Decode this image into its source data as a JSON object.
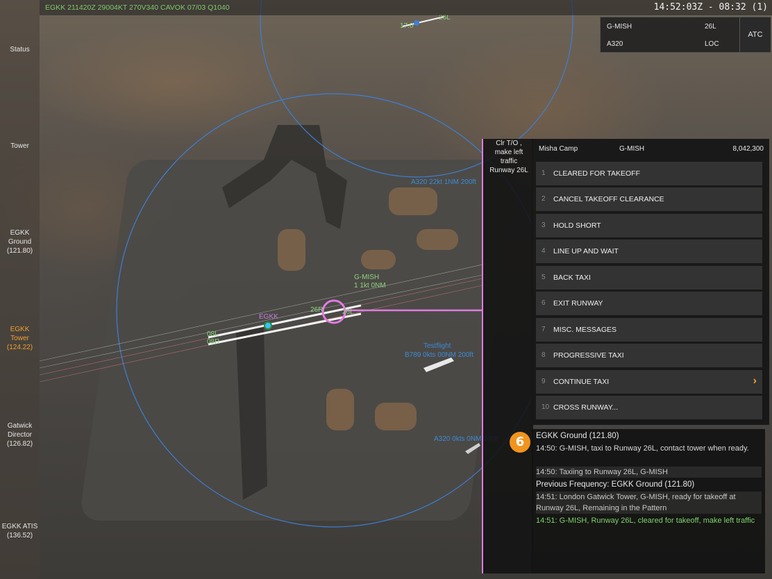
{
  "top_bar": {
    "metar": "EGKK 211420Z 29004KT 270V340 CAVOK 07/03 Q1040",
    "clock": "14:52:03Z - 08:32 (1)"
  },
  "left_rail": {
    "items": [
      {
        "label": "Status"
      },
      {
        "label": "Tower"
      },
      {
        "label": "EGKK\nGround\n(121.80)"
      },
      {
        "label": "EGKK\nTower\n(124.22)",
        "active": true
      },
      {
        "label": "Gatwick\nDirector\n(126.82)"
      },
      {
        "label": "EGKK ATIS\n(136.52)"
      }
    ]
  },
  "info_panel": {
    "callsign": "G-MISH",
    "runway": "26L",
    "type": "A320",
    "mode": "LOC",
    "atc_label": "ATC"
  },
  "map": {
    "airport_label": "EGKK",
    "runway_labels": [
      "26R",
      "26L",
      "08L",
      "08R"
    ],
    "aircraft_label": "G-MISH",
    "aircraft_sub": "1 1kt 0NM",
    "traffic_1_line1": "Testflight",
    "traffic_1_line2": "B789 0kts 00NM 200ft",
    "traffic_2": "A320 22kt 1NM 200ft",
    "traffic_3": "A320 0kts 0NM 200ft",
    "top_runway": "26L",
    "top_traffic": "17.0"
  },
  "clearance": {
    "text": "Clr T/O ,\nmake left\ntraffic\nRunway 26L"
  },
  "command_panel": {
    "pilot": "Misha Camp",
    "callsign": "G-MISH",
    "score": "8,042,300",
    "items": [
      {
        "num": "1",
        "label": "CLEARED FOR TAKEOFF"
      },
      {
        "num": "2",
        "label": "CANCEL TAKEOFF CLEARANCE"
      },
      {
        "num": "3",
        "label": "HOLD SHORT"
      },
      {
        "num": "4",
        "label": "LINE UP AND WAIT"
      },
      {
        "num": "5",
        "label": "BACK TAXI"
      },
      {
        "num": "6",
        "label": "EXIT RUNWAY"
      },
      {
        "num": "7",
        "label": "MISC. MESSAGES"
      },
      {
        "num": "8",
        "label": "PROGRESSIVE TAXI"
      },
      {
        "num": "9",
        "label": "CONTINUE TAXI",
        "submenu": true
      },
      {
        "num": "10",
        "label": "CROSS RUNWAY..."
      }
    ]
  },
  "badge": "6",
  "log": {
    "lines": [
      {
        "text": "EGKK Ground (121.80)",
        "kind": "freq"
      },
      {
        "text": "14:50: G-MISH, taxi to Runway 26L, contact tower when ready.",
        "kind": "normal"
      },
      {
        "text": "14:50: Taxiing to Runway 26L, G-MISH",
        "kind": "dim"
      },
      {
        "text": "Previous Frequency: EGKK Ground (121.80)",
        "kind": "freq"
      },
      {
        "text": "14:51: London Gatwick Tower, G-MISH, ready for takeoff at Runway 26L, Remaining in the Pattern",
        "kind": "dim"
      },
      {
        "text": "14:51: G-MISH, Runway 26L, cleared for takeoff, make left traffic",
        "kind": "gr"
      }
    ]
  },
  "colors": {
    "accent": "#f0a030",
    "selection": "#e07ce0",
    "range_ring": "#3d7fd6",
    "good": "#7ed36a"
  }
}
